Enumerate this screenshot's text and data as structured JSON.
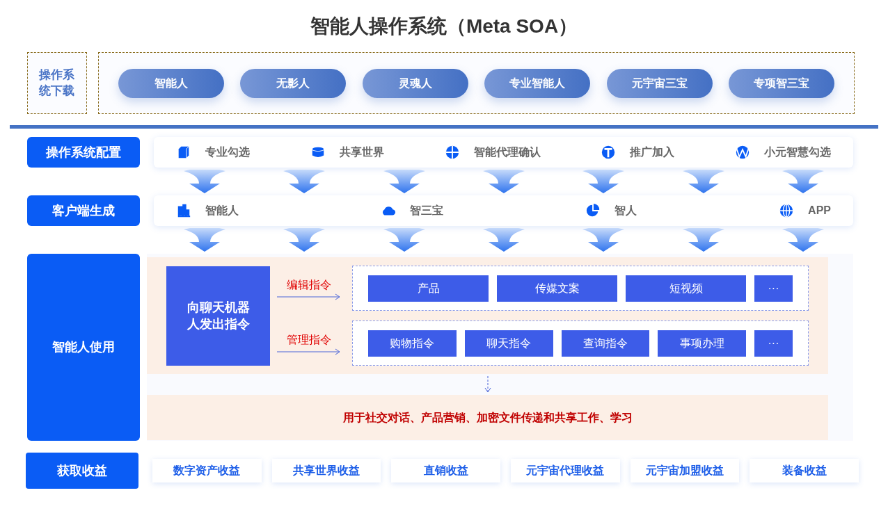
{
  "title": "智能人操作系统（Meta SOA）",
  "download": {
    "label": "操作系统下载",
    "items": [
      "智能人",
      "无影人",
      "灵魂人",
      "专业智能人",
      "元宇宙三宝",
      "专项智三宝"
    ]
  },
  "rows": [
    {
      "label": "操作系统配置",
      "items": [
        {
          "label": "专业勾选",
          "kind": "cube"
        },
        {
          "label": "共享世界",
          "kind": "database"
        },
        {
          "label": "智能代理确认",
          "kind": "crosshair"
        },
        {
          "label": "推广加入",
          "kind": "tcircle"
        },
        {
          "label": "小元智慧勾选",
          "kind": "wave"
        }
      ]
    },
    {
      "label": "客户端生成",
      "items": [
        {
          "label": "智能人",
          "kind": "building"
        },
        {
          "label": "智三宝",
          "kind": "cloud"
        },
        {
          "label": "智人",
          "kind": "pie"
        },
        {
          "label": "APP",
          "kind": "globe"
        }
      ]
    }
  ],
  "usage": {
    "label": "智能人使用",
    "source": "向聊天机器人发出指令",
    "groups": [
      {
        "command": "编辑指令",
        "items": [
          "产品",
          "传媒文案",
          "短视频",
          "···"
        ]
      },
      {
        "command": "管理指令",
        "items": [
          "购物指令",
          "聊天指令",
          "查询指令",
          "事项办理",
          "···"
        ]
      }
    ],
    "result": "用于社交对话、产品营销、加密文件传递和共享工作、学习"
  },
  "earnings": {
    "label": "获取收益",
    "items": [
      "数字资产收益",
      "共享世界收益",
      "直销收益",
      "元宇宙代理收益",
      "元宇宙加盟收益",
      "装备收益"
    ]
  }
}
